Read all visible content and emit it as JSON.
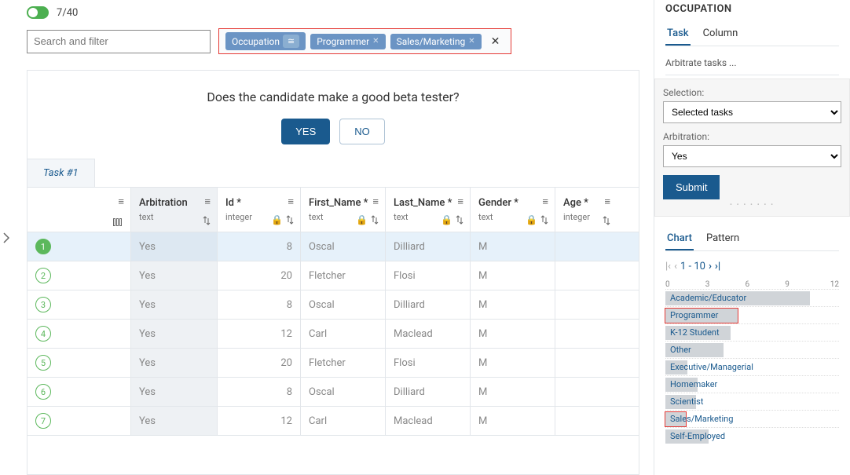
{
  "header": {
    "count_current": "7",
    "count_total": "40",
    "search_placeholder": "Search and filter"
  },
  "filter": {
    "field": "Occupation",
    "op": "≅",
    "values": [
      "Programmer",
      "Sales/Marketing"
    ]
  },
  "task": {
    "question": "Does the candidate make a good beta tester?",
    "yes": "YES",
    "no": "NO",
    "tab": "Task #1"
  },
  "columns": [
    {
      "label": "",
      "type": ""
    },
    {
      "label": "Arbitration",
      "type": "text"
    },
    {
      "label": "Id *",
      "type": "integer"
    },
    {
      "label": "First_Name *",
      "type": "text"
    },
    {
      "label": "Last_Name *",
      "type": "text"
    },
    {
      "label": "Gender *",
      "type": "text"
    },
    {
      "label": "Age *",
      "type": "integer"
    }
  ],
  "rows": [
    {
      "n": "1",
      "sel": true,
      "arb": "Yes",
      "id": "8",
      "fn": "Oscal",
      "ln": "Dilliard",
      "g": "M",
      "age": ""
    },
    {
      "n": "2",
      "arb": "Yes",
      "id": "20",
      "fn": "Fletcher",
      "ln": "Flosi",
      "g": "M",
      "age": ""
    },
    {
      "n": "3",
      "arb": "Yes",
      "id": "8",
      "fn": "Oscal",
      "ln": "Dilliard",
      "g": "M",
      "age": ""
    },
    {
      "n": "4",
      "arb": "Yes",
      "id": "12",
      "fn": "Carl",
      "ln": "Maclead",
      "g": "M",
      "age": ""
    },
    {
      "n": "5",
      "arb": "Yes",
      "id": "20",
      "fn": "Fletcher",
      "ln": "Flosi",
      "g": "M",
      "age": ""
    },
    {
      "n": "6",
      "arb": "Yes",
      "id": "8",
      "fn": "Oscal",
      "ln": "Dilliard",
      "g": "M",
      "age": ""
    },
    {
      "n": "7",
      "arb": "Yes",
      "id": "12",
      "fn": "Carl",
      "ln": "Maclead",
      "g": "M",
      "age": ""
    }
  ],
  "side": {
    "title": "OCCUPATION",
    "tabs": [
      "Task",
      "Column"
    ],
    "desc": "Arbitrate tasks ...",
    "selection_label": "Selection:",
    "selection_value": "Selected tasks",
    "arbitration_label": "Arbitration:",
    "arbitration_value": "Yes",
    "submit": "Submit",
    "tabs2": [
      "Chart",
      "Pattern"
    ],
    "pager": "1 - 10"
  },
  "chart_data": {
    "type": "bar",
    "orientation": "horizontal",
    "xlim": [
      0,
      12
    ],
    "xticks": [
      0,
      3,
      6,
      9,
      12
    ],
    "categories": [
      "Academic/Educator",
      "Programmer",
      "K-12 Student",
      "Other",
      "Executive/Managerial",
      "Homemaker",
      "Scientist",
      "Sales/Marketing",
      "Self-Employed"
    ],
    "values": [
      10,
      5,
      4.5,
      4,
      1.5,
      2.2,
      2.1,
      1.4,
      3
    ],
    "highlighted": [
      "Programmer",
      "Sales/Marketing"
    ]
  }
}
